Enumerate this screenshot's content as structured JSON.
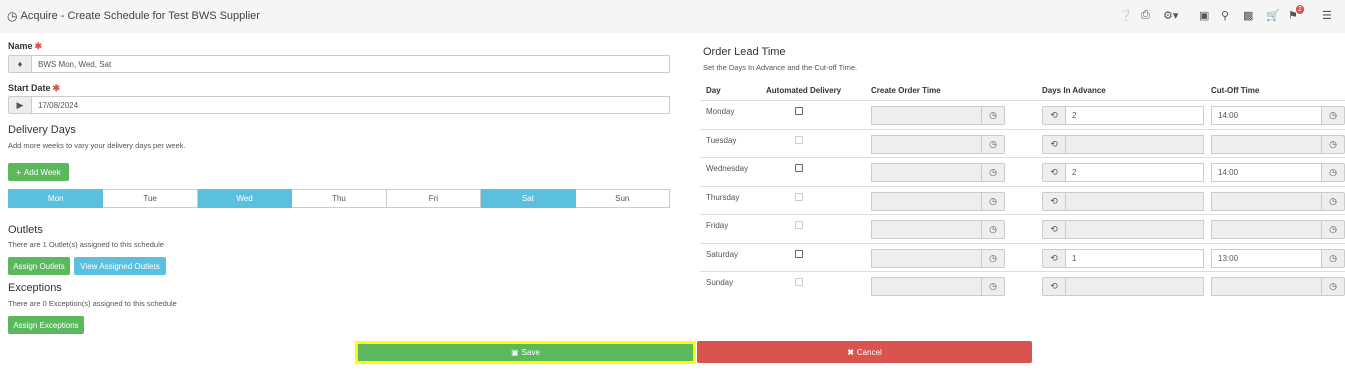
{
  "header": {
    "title": "Acquire - Create Schedule for Test BWS Supplier",
    "icons": [
      "help-icon",
      "print-icon",
      "settings-icon",
      "media-icon",
      "search-icon",
      "chart-icon",
      "cart-icon",
      "notifications-icon",
      "list-icon"
    ],
    "notification_count": "2"
  },
  "form": {
    "name_label": "Name",
    "name_value": "BWS Mon, Wed, Sat",
    "start_date_label": "Start Date",
    "start_date_value": "17/08/2024",
    "required_mark": "✱"
  },
  "delivery": {
    "title": "Delivery Days",
    "help": "Add more weeks to vary your delivery days per week.",
    "add_week_label": "Add Week",
    "days": [
      {
        "label": "Mon",
        "selected": true
      },
      {
        "label": "Tue",
        "selected": false
      },
      {
        "label": "Wed",
        "selected": true
      },
      {
        "label": "Thu",
        "selected": false
      },
      {
        "label": "Fri",
        "selected": false
      },
      {
        "label": "Sat",
        "selected": true
      },
      {
        "label": "Sun",
        "selected": false
      }
    ]
  },
  "outlets": {
    "title": "Outlets",
    "help": "There are 1 Outlet(s) assigned to this schedule",
    "assign_label": "Assign Outlets",
    "view_label": "View Assigned Outlets"
  },
  "exceptions": {
    "title": "Exceptions",
    "help": "There are 0 Exception(s) assigned to this schedule",
    "assign_label": "Assign Exceptions"
  },
  "lead_time": {
    "title": "Order Lead Time",
    "help": "Set the Days In Advance and the Cut-off Time.",
    "columns": {
      "day": "Day",
      "automated": "Automated Delivery",
      "create_order": "Create Order Time",
      "days_in_advance": "Days In Advance",
      "cutoff": "Cut-Off Time"
    },
    "rows": [
      {
        "day": "Monday",
        "enabled": true,
        "create_order_time": "",
        "days_in_advance": "2",
        "cutoff": "14:00"
      },
      {
        "day": "Tuesday",
        "enabled": false,
        "create_order_time": "",
        "days_in_advance": "",
        "cutoff": ""
      },
      {
        "day": "Wednesday",
        "enabled": true,
        "create_order_time": "",
        "days_in_advance": "2",
        "cutoff": "14:00"
      },
      {
        "day": "Thursday",
        "enabled": false,
        "create_order_time": "",
        "days_in_advance": "",
        "cutoff": ""
      },
      {
        "day": "Friday",
        "enabled": false,
        "create_order_time": "",
        "days_in_advance": "",
        "cutoff": ""
      },
      {
        "day": "Saturday",
        "enabled": true,
        "create_order_time": "",
        "days_in_advance": "1",
        "cutoff": "13:00"
      },
      {
        "day": "Sunday",
        "enabled": false,
        "create_order_time": "",
        "days_in_advance": "",
        "cutoff": ""
      }
    ]
  },
  "footer": {
    "save_label": "Save",
    "cancel_label": "Cancel"
  },
  "colors": {
    "primary_blue": "#5bc0de",
    "success_green": "#5cb85c",
    "danger_red": "#d9534f",
    "highlight_yellow": "#ffff00"
  }
}
